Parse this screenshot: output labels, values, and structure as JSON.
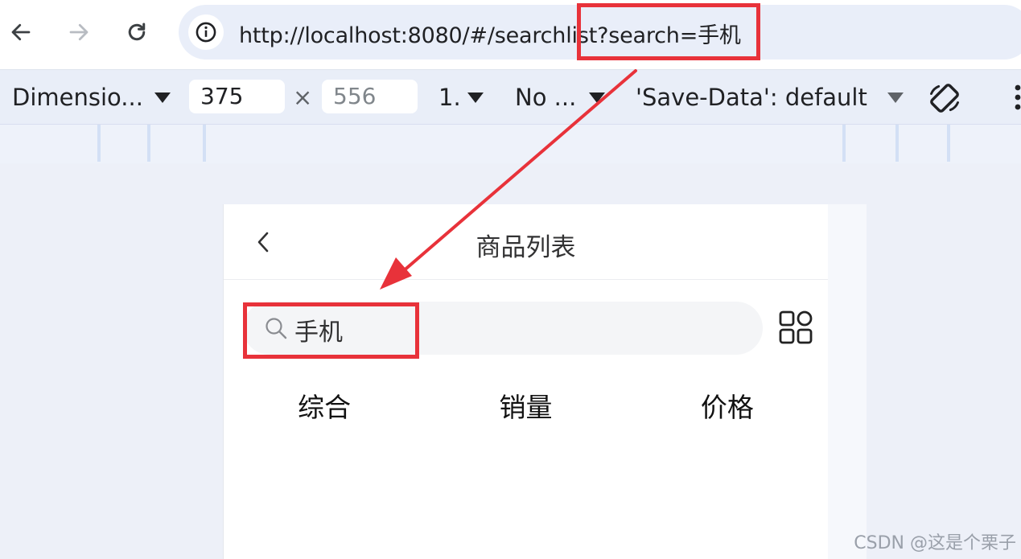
{
  "browser": {
    "url": "http://localhost:8080/#/searchlist?search=手机",
    "back_icon": "arrow-left-icon",
    "forward_icon": "arrow-right-icon",
    "reload_icon": "reload-icon",
    "site_info_icon": "info-icon"
  },
  "device_toolbar": {
    "device_select": "Dimensio...",
    "width_value": "375",
    "times_symbol": "×",
    "height_placeholder": "556",
    "dpr_select": "1.",
    "throttle_select": "No ...",
    "save_data_select": "'Save-Data': default",
    "rotate_icon": "rotate-icon",
    "more_icon": "more-vertical-icon"
  },
  "app": {
    "page_title": "商品列表",
    "back_icon": "chevron-left-icon",
    "search_value": "手机",
    "search_icon": "search-icon",
    "view_toggle_icon": "grid-icon",
    "tabs": [
      "综合",
      "销量",
      "价格"
    ]
  },
  "watermark": "CSDN @这是个栗子",
  "colors": {
    "annotation_red": "#e8323a",
    "omnibox_bg": "#e9eef9",
    "stage_bg": "#edf0f8"
  }
}
